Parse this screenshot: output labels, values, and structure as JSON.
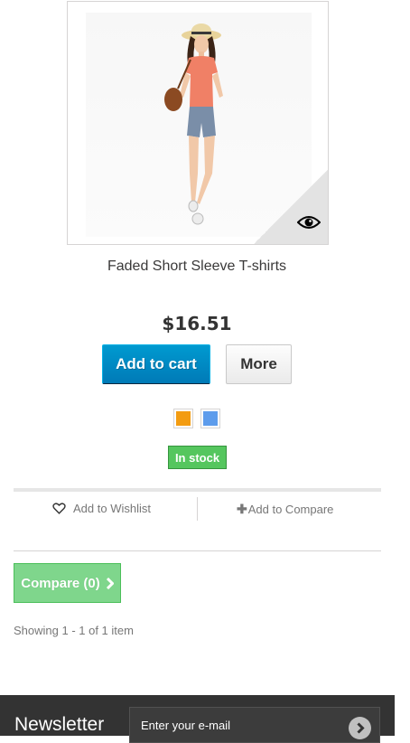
{
  "product": {
    "name": "Faded Short Sleeve T-shirts",
    "price": "$16.51",
    "add_to_cart_label": "Add to cart",
    "more_label": "More",
    "swatches": [
      {
        "name": "Orange",
        "color": "#f39c11"
      },
      {
        "name": "Blue",
        "color": "#5d9cec"
      }
    ],
    "stock_label": "In stock"
  },
  "functional_buttons": {
    "wishlist_label": "Add to Wishlist",
    "compare_label": "Add to Compare"
  },
  "compare_button": {
    "label": "Compare (0)"
  },
  "pagination": {
    "showing_text": "Showing 1 - 1 of 1 item"
  },
  "newsletter": {
    "title": "Newsletter",
    "placeholder": "Enter your e-mail"
  },
  "colors": {
    "accent_blue": "#0088cc",
    "stock_green": "#55c65e",
    "compare_green": "#7fd68c",
    "footer_bg": "#333333"
  }
}
